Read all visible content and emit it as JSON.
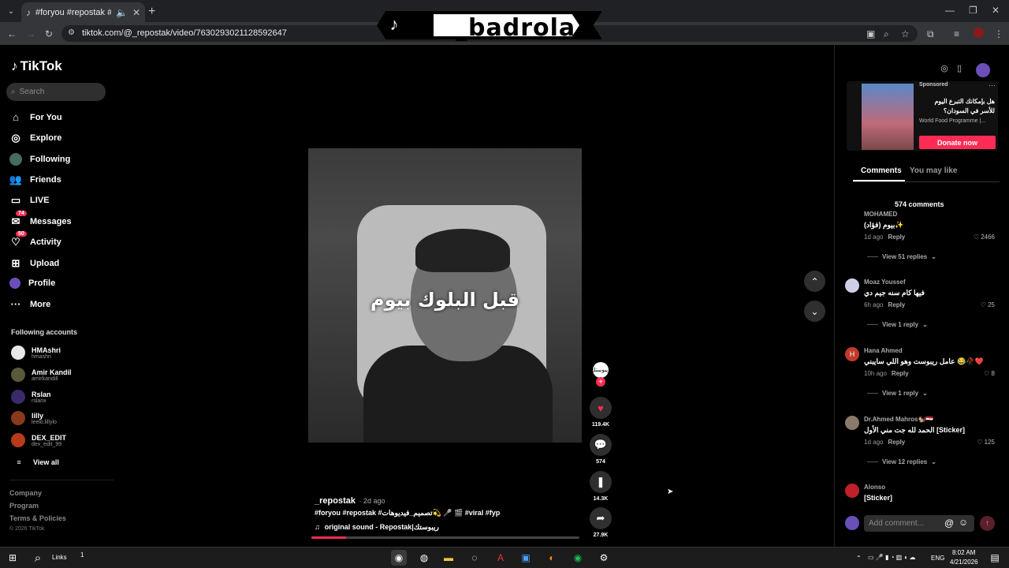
{
  "browser": {
    "tab_title": "#foryou #repostak #تصميم_فيديوهات",
    "url": "tiktok.com/@_repostak/video/7630293021128592647",
    "new_tab": "+"
  },
  "banner": {
    "text": "_badrola"
  },
  "sidebar": {
    "logo": "TikTok",
    "search_placeholder": "Search",
    "nav": [
      {
        "label": "For You",
        "icon": "home-icon"
      },
      {
        "label": "Explore",
        "icon": "compass-icon"
      },
      {
        "label": "Following",
        "icon": "following-icon"
      },
      {
        "label": "Friends",
        "icon": "friends-icon"
      },
      {
        "label": "LIVE",
        "icon": "live-icon"
      },
      {
        "label": "Messages",
        "icon": "messages-icon",
        "badge": "74"
      },
      {
        "label": "Activity",
        "icon": "activity-icon",
        "badge": "50"
      },
      {
        "label": "Upload",
        "icon": "upload-icon"
      },
      {
        "label": "Profile",
        "icon": "profile-icon"
      },
      {
        "label": "More",
        "icon": "more-icon"
      }
    ],
    "following_title": "Following accounts",
    "accounts": [
      {
        "name": "HMAshri",
        "handle": "hmashri",
        "color": "#e8e8e8"
      },
      {
        "name": "Amir Kandil",
        "handle": "amirkandill",
        "color": "#5a5a3a"
      },
      {
        "name": "Rslan",
        "handle": "rslanx",
        "color": "#3a2a6a"
      },
      {
        "name": "lilly",
        "handle": "leelo.lillylo",
        "color": "#8a3a1a"
      },
      {
        "name": "DEX_EDIT",
        "handle": "dex_edit_99",
        "color": "#b83a1a"
      }
    ],
    "view_all": "View all",
    "footer": [
      "Company",
      "Program",
      "Terms & Policies"
    ],
    "copyright": "© 2026 TikTok"
  },
  "video": {
    "caption": "قبل البلوك بيوم",
    "username": "_repostak",
    "time": "· 2d ago",
    "description": "#foryou #repostak #تصميم_فيديوهات💫 🎤 🎬 #viral #fyp",
    "sound": "original sound - Repostak|ريبوستك",
    "creator_label": "ريبوستك",
    "likes": "119.4K",
    "comments": "574",
    "saves": "14.3K",
    "shares": "27.9K",
    "progress": 0.13
  },
  "right_panel": {
    "ad": {
      "sponsored": "Sponsored",
      "title": "هل بإمكانك التبرع اليوم للأسر في السودان؟",
      "org": "World Food Programme |...",
      "button": "Donate now"
    },
    "tabs": [
      "Comments",
      "You may like"
    ],
    "comment_count": "574 comments",
    "comments": [
      {
        "user": "MOHAMED",
        "text": "بيوم (فؤاد)✨",
        "time": "1d ago",
        "likes": "2466",
        "view_replies": "View 51 replies",
        "color": ""
      },
      {
        "user": "Moaz Youssef",
        "text": "فيها كام سنه جيم دي",
        "time": "6h ago",
        "likes": "25",
        "view_replies": "View 1 reply",
        "color": "#cfcfe8"
      },
      {
        "user": "Hana Ahmed",
        "text": "عامل ريبوست وهو اللي سايبني 😂🥀❤️",
        "time": "10h ago",
        "likes": "8",
        "view_replies": "View 1 reply",
        "color": "#c0392b"
      },
      {
        "user": "Dr.Ahmed Mahros🐿️🇪🇬",
        "text": "الحمد لله جت مني الأول [Sticker]",
        "time": "1d ago",
        "likes": "125",
        "view_replies": "View 12 replies",
        "color": "#8a7a6a"
      },
      {
        "user": "Alonso",
        "text": "[Sticker]",
        "time": "",
        "likes": "",
        "view_replies": "",
        "color": "#c0202a"
      }
    ],
    "reply_label": "Reply",
    "add_comment_placeholder": "Add comment..."
  },
  "taskbar": {
    "search_label": "Links",
    "search_badge": "1",
    "lang": "ENG",
    "time": "8:02 AM",
    "date": "4/21/2026"
  }
}
